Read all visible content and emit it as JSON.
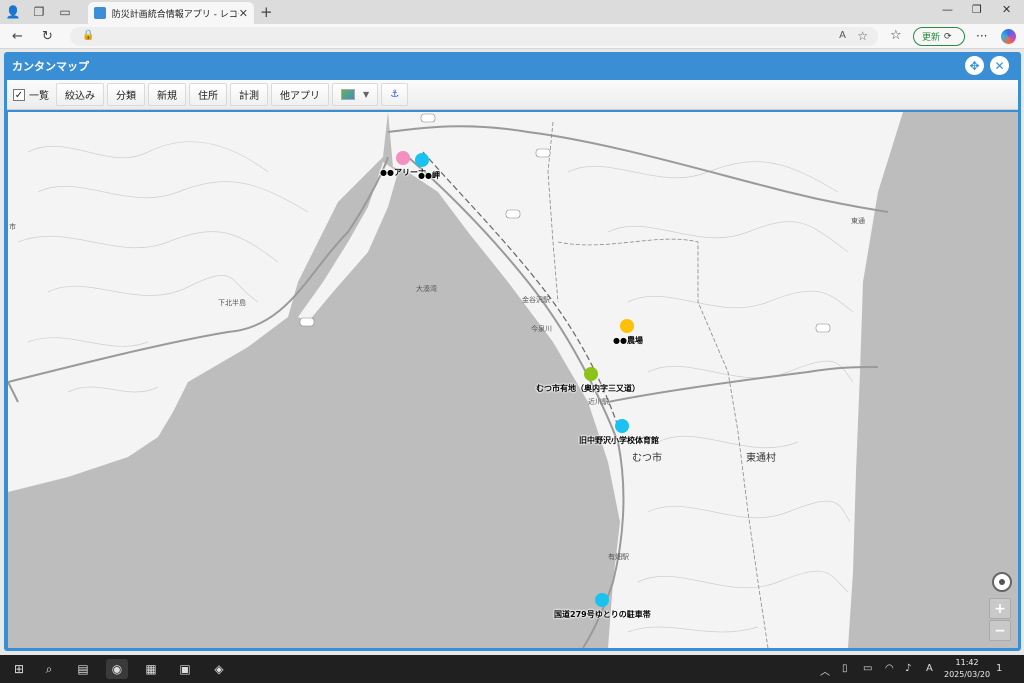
{
  "browser": {
    "tab_title": "防災計画統合情報アプリ - レコードの",
    "update_label": "更新",
    "read_aloud_label": "A",
    "more_label": "···"
  },
  "app": {
    "title": "カンタンマップ"
  },
  "toolbar": {
    "list_label": "一覧",
    "list_checked": true,
    "filter_label": "絞込み",
    "classify_label": "分類",
    "new_label": "新規",
    "address_label": "住所",
    "measure_label": "計測",
    "other_apps_label": "他アプリ"
  },
  "map": {
    "markers": [
      {
        "label": "●●アリーナ",
        "color": "#f48fc1"
      },
      {
        "label": "●●岬",
        "color": "#19c2f0"
      },
      {
        "label": "●●農場",
        "color": "#ffc107"
      },
      {
        "label": "むつ市有地（奥内字三又道）",
        "color": "#8bc318"
      },
      {
        "label": "旧中野沢小学校体育館",
        "color": "#19c2f0"
      },
      {
        "label": "国道279号ゆとりの駐車帯",
        "color": "#19c2f0"
      }
    ],
    "place_names": {
      "mutsu_city": "むつ市",
      "higashidori": "東通村",
      "shimokita_peninsula": "下北半島",
      "ominato_bay": "大湊湾",
      "kanayasawa_station": "金谷沢駅",
      "imaizumi": "今泉川",
      "chikagawa_station": "近川駅",
      "arikabata_station": "有畑駅",
      "higashidori_north": "東通",
      "shi_label": "市"
    },
    "zoom_in": "+",
    "zoom_out": "−"
  },
  "taskbar": {
    "time": "11:42",
    "date": "2025/03/20",
    "ime": "A",
    "notify": "1"
  }
}
